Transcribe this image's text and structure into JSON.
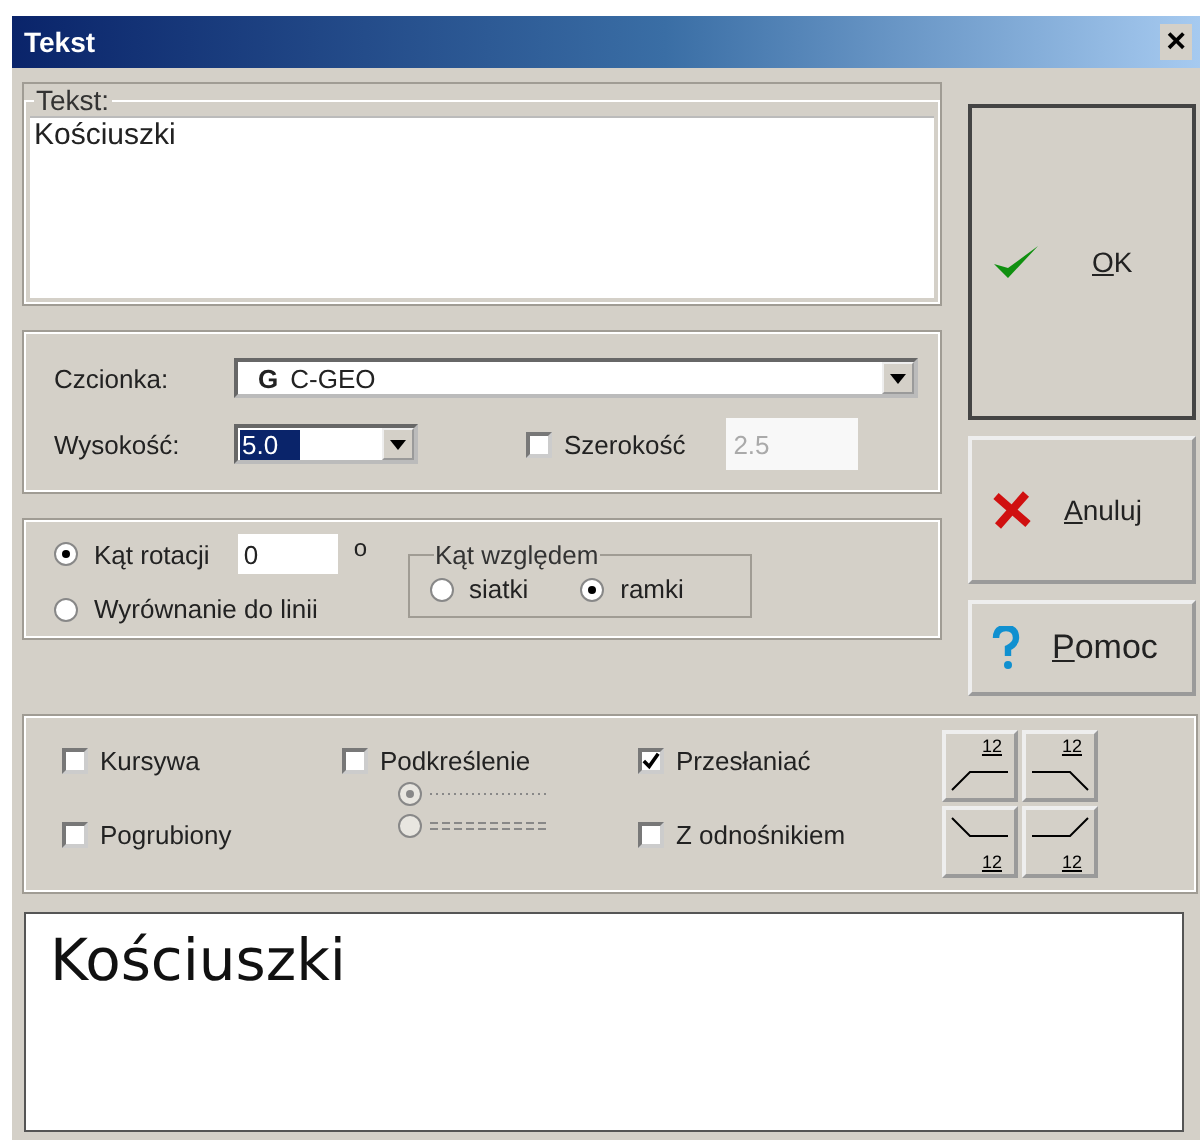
{
  "window": {
    "title": "Tekst",
    "close": "×"
  },
  "text_group": {
    "legend": "Tekst:",
    "value": "Kościuszki"
  },
  "font": {
    "label": "Czcionka:",
    "icon_glyph": "G",
    "value": "C-GEO"
  },
  "height": {
    "label": "Wysokość:",
    "value": "5.0"
  },
  "width": {
    "label": "Szerokość",
    "checked": false,
    "value": "2.5",
    "disabled": true
  },
  "rotation": {
    "options": [
      {
        "label": "Kąt rotacji",
        "selected": true
      },
      {
        "label": "Wyrównanie do linii",
        "selected": false
      }
    ],
    "angle": "0",
    "unit": "o"
  },
  "relative": {
    "legend": "Kąt względem",
    "options": [
      {
        "label": "siatki",
        "selected": false
      },
      {
        "label": "ramki",
        "selected": true
      }
    ]
  },
  "styles": [
    {
      "label": "Kursywa",
      "checked": false
    },
    {
      "label": "Pogrubiony",
      "checked": false
    },
    {
      "label": "Podkreślenie",
      "checked": false
    },
    {
      "label": "Przesłaniać",
      "checked": true
    },
    {
      "label": "Z odnośnikiem",
      "checked": false
    }
  ],
  "underline_styles": [
    {
      "kind": "dotted",
      "selected": true,
      "disabled": true
    },
    {
      "kind": "double",
      "selected": false,
      "disabled": true
    }
  ],
  "placements": [
    {
      "kind": "above-rising",
      "label": "12"
    },
    {
      "kind": "above-falling",
      "label": "12"
    },
    {
      "kind": "below-falling",
      "label": "12"
    },
    {
      "kind": "below-rising",
      "label": "12"
    }
  ],
  "buttons": [
    {
      "kind": "ok",
      "label": "OK"
    },
    {
      "kind": "cancel",
      "label": "Anuluj"
    },
    {
      "kind": "help",
      "label": "Pomoc"
    }
  ],
  "preview": {
    "text": "Kościuszki"
  }
}
